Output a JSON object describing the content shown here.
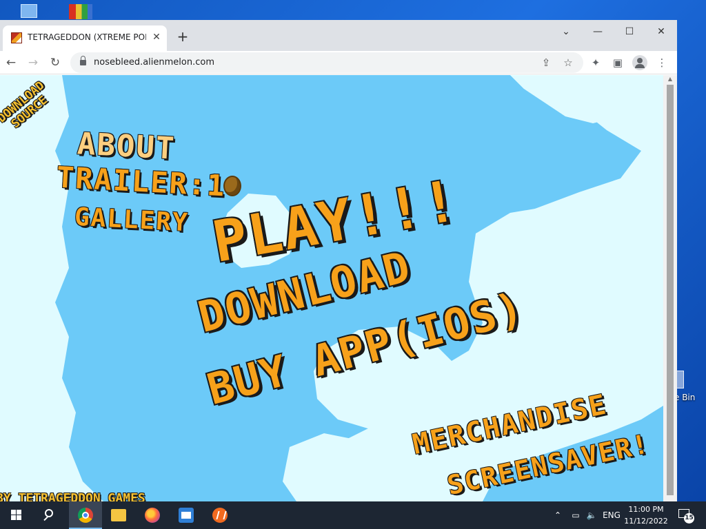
{
  "browser": {
    "tab_title": "TETRAGEDDON (XTREME POLYGON",
    "tab_close": "✕",
    "new_tab": "+",
    "url": "nosebleed.alienmelon.com",
    "controls": {
      "minimize": "—",
      "maximize": "☐",
      "close": "✕",
      "tab_search": "⌄"
    },
    "nav": {
      "back": "←",
      "forward": "→",
      "reload": "↻"
    },
    "toolbar_icons": [
      "share-icon",
      "star-icon",
      "extensions-icon",
      "side-panel-icon",
      "profile-icon",
      "menu-icon"
    ]
  },
  "game": {
    "download_source": [
      "DOWNLOAD",
      "SOURCE"
    ],
    "about": "ABOUT",
    "trailer": "TRAILER:1",
    "gallery": "GALLERY",
    "play": "PLAY!!!",
    "download": "DOWNLOAD",
    "buy_app": "BUY APP(IOS)",
    "merchandise": "MERCHANDISE",
    "screensaver": "SCREENSAVER!",
    "footer": "BY TETRAGEDDON GAMES"
  },
  "desktop": {
    "recycle_bin_label": "e Bin"
  },
  "taskbar": {
    "apps": [
      "chrome-icon",
      "file-explorer-icon",
      "firefox-icon",
      "app-box-icon",
      "orange-app-icon"
    ],
    "tray": {
      "language": "ENG"
    },
    "time": "11:00 PM",
    "date": "11/12/2022",
    "notification_count": "15"
  },
  "colors": {
    "sky_light": "#e0fbff",
    "sky_blue": "#6ccaf8",
    "text_orange": "#f7a11a",
    "text_outline": "#1a1a1a",
    "taskbar": "#1d2633",
    "tabbar": "#dee1e6"
  }
}
